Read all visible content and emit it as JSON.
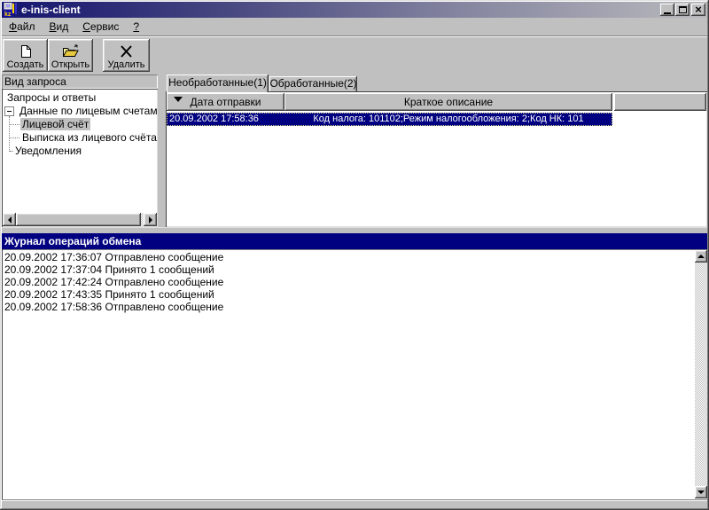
{
  "window": {
    "title": "e-inis-client",
    "app_icon": "kz-client-icon"
  },
  "menu": {
    "items": [
      {
        "label": "Файл"
      },
      {
        "label": "Вид"
      },
      {
        "label": "Сервис"
      },
      {
        "label": "?"
      }
    ]
  },
  "toolbar": {
    "buttons": [
      {
        "label": "Создать",
        "icon": "new-document-icon"
      },
      {
        "label": "Открыть",
        "icon": "open-folder-icon"
      },
      {
        "label": "Удалить",
        "icon": "delete-x-icon"
      }
    ]
  },
  "request_panel": {
    "header": "Вид запроса",
    "tree_items": [
      {
        "label": "Запросы и ответы",
        "level": 0,
        "selected": false
      },
      {
        "label": "Данные по лицевым счетам",
        "level": 0,
        "expander": "minus",
        "selected": false
      },
      {
        "label": "Лицевой счёт",
        "level": 1,
        "selected": true
      },
      {
        "label": "Выписка из лицевого счёта",
        "level": 1,
        "selected": false
      },
      {
        "label": "Уведомления",
        "level": 0,
        "selected": false
      }
    ]
  },
  "message_tabs": [
    {
      "label": "Необработанные(1)",
      "active": true
    },
    {
      "label": "Обработанные(2)",
      "active": false
    }
  ],
  "message_table": {
    "sort_icon": "down-arrow-icon",
    "columns": [
      {
        "label": "Дата отправки"
      },
      {
        "label": "Краткое описание"
      },
      {
        "label": ""
      }
    ],
    "rows": [
      {
        "date": "20.09.2002 17:58:36",
        "description": "Код налога: 101102;Режим налогообложения: 2;Код НК: 101",
        "selected": true
      }
    ]
  },
  "journal": {
    "title": "Журнал операций обмена",
    "entries": [
      "20.09.2002 17:36:07 Отправлено сообщение",
      "20.09.2002 17:37:04 Принято 1 сообщений",
      "20.09.2002 17:42:24 Отправлено сообщение",
      "20.09.2002 17:43:35 Принято 1 сообщений",
      "20.09.2002 17:58:36 Отправлено сообщение"
    ]
  },
  "colors": {
    "chrome": "#c0c0c0",
    "titlebar_gradient_left": "#14146f",
    "titlebar_gradient_right": "#b9b9bd",
    "selection": "#000080",
    "selection_text": "#ffffff",
    "journal_header_bg": "#000080",
    "folder_icon_yellow": "#e8c93e"
  }
}
